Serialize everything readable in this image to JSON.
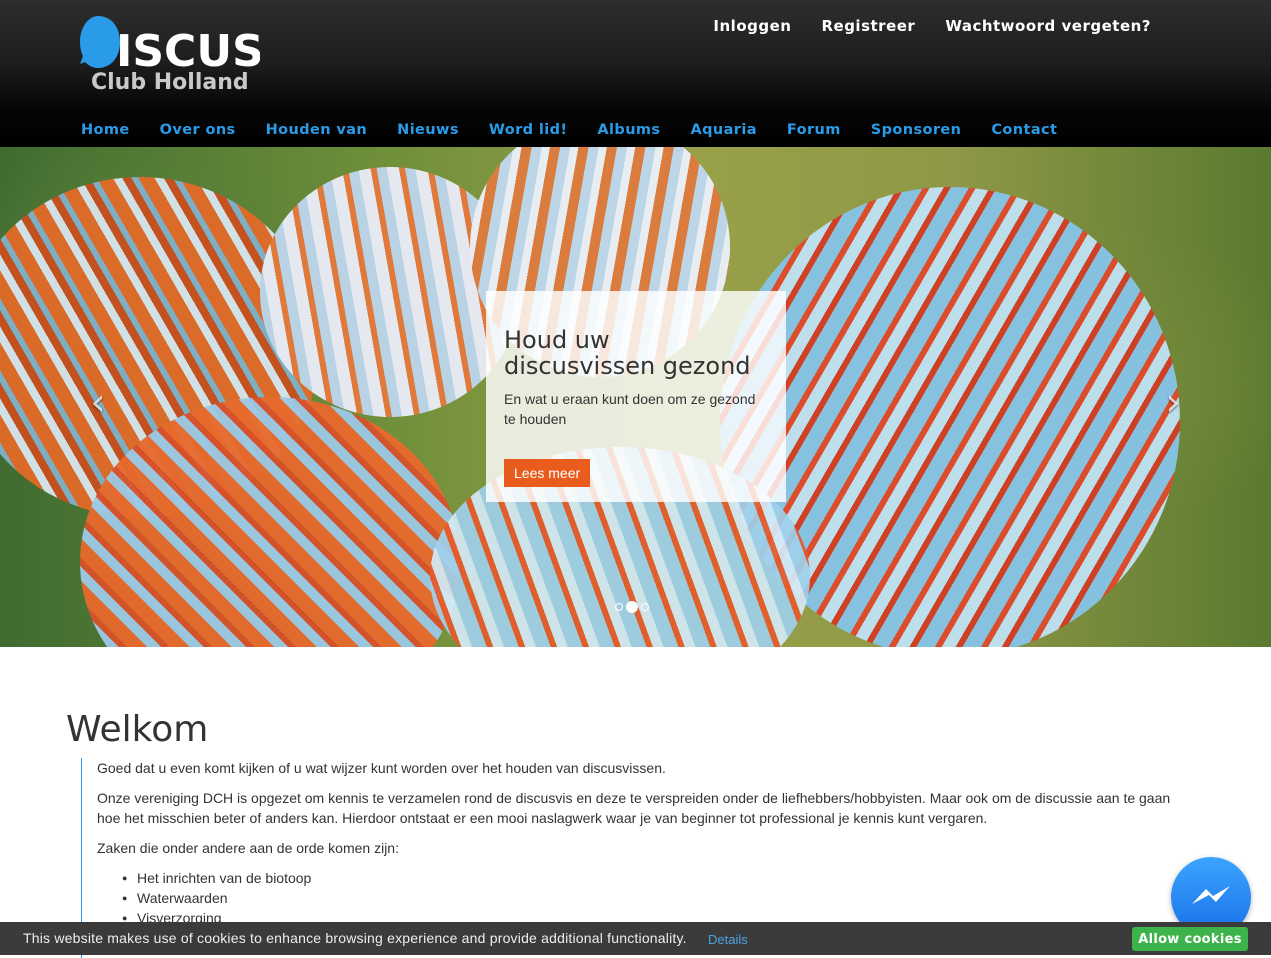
{
  "logo": {
    "main": "ISCUS",
    "sub": "Club Holland"
  },
  "top_links": [
    "Inloggen",
    "Registreer",
    "Wachtwoord vergeten?"
  ],
  "nav": [
    "Home",
    "Over ons",
    "Houden van",
    "Nieuws",
    "Word lid!",
    "Albums",
    "Aquaria",
    "Forum",
    "Sponsoren",
    "Contact"
  ],
  "hero": {
    "prev_icon": "chevron-left-icon",
    "next_icon": "chevron-right-icon",
    "caption_title": "Houd uw discusvissen gezond",
    "caption_text": "En wat u eraan kunt doen om ze gezond te houden",
    "button_label": "Lees meer",
    "slide_count": 3,
    "active_slide": 2
  },
  "content": {
    "heading": "Welkom",
    "paragraphs": [
      "Goed dat u even komt kijken of u wat wijzer kunt worden over het houden van discusvissen.",
      "Onze vereniging DCH is opgezet om kennis te verzamelen rond de discusvis en deze te verspreiden onder de liefhebbers/hobbyisten. Maar ook om de discussie aan te gaan hoe het misschien beter of anders kan. Hierdoor ontstaat er een mooi naslagwerk waar je van beginner tot professional je kennis kunt vergaren.",
      "Zaken die onder andere aan de orde komen zijn:"
    ],
    "list": [
      "Het inrichten van de biotoop",
      "Waterwaarden",
      "Visverzorging"
    ]
  },
  "cookie": {
    "text": "This website makes use of cookies to enhance browsing experience and provide additional functionality.",
    "link": "Details",
    "button": "Allow cookies"
  },
  "colors": {
    "accent": "#2a9be8",
    "button": "#e85c1e",
    "cookie_button": "#3cb44b",
    "logo_blue": "#2a9be8"
  },
  "icons": {
    "messenger": "messenger-icon"
  }
}
